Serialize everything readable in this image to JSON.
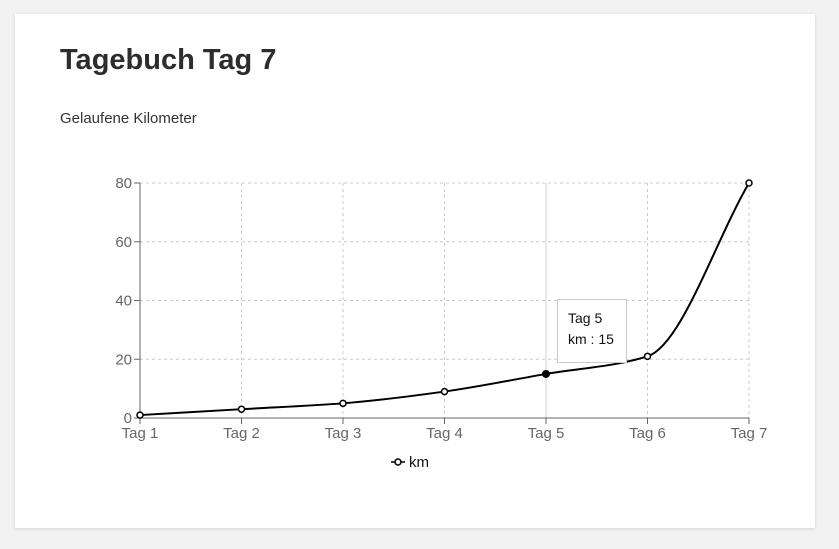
{
  "page": {
    "title": "Tagebuch Tag 7",
    "subtitle": "Gelaufene Kilometer"
  },
  "chart_data": {
    "type": "line",
    "categories": [
      "Tag 1",
      "Tag 2",
      "Tag 3",
      "Tag 4",
      "Tag 5",
      "Tag 6",
      "Tag 7"
    ],
    "series": [
      {
        "name": "km",
        "values": [
          1,
          3,
          5,
          9,
          15,
          21,
          80
        ]
      }
    ],
    "ylim": [
      0,
      80
    ],
    "yticks": [
      0,
      20,
      40,
      60,
      80
    ],
    "grid": true,
    "legend": "bottom",
    "line_color": "#000000",
    "grid_color": "#cccccc",
    "active_index": 4
  },
  "tooltip": {
    "label": "Tag 5",
    "series_name": "km",
    "separator": " : ",
    "value": "15"
  }
}
